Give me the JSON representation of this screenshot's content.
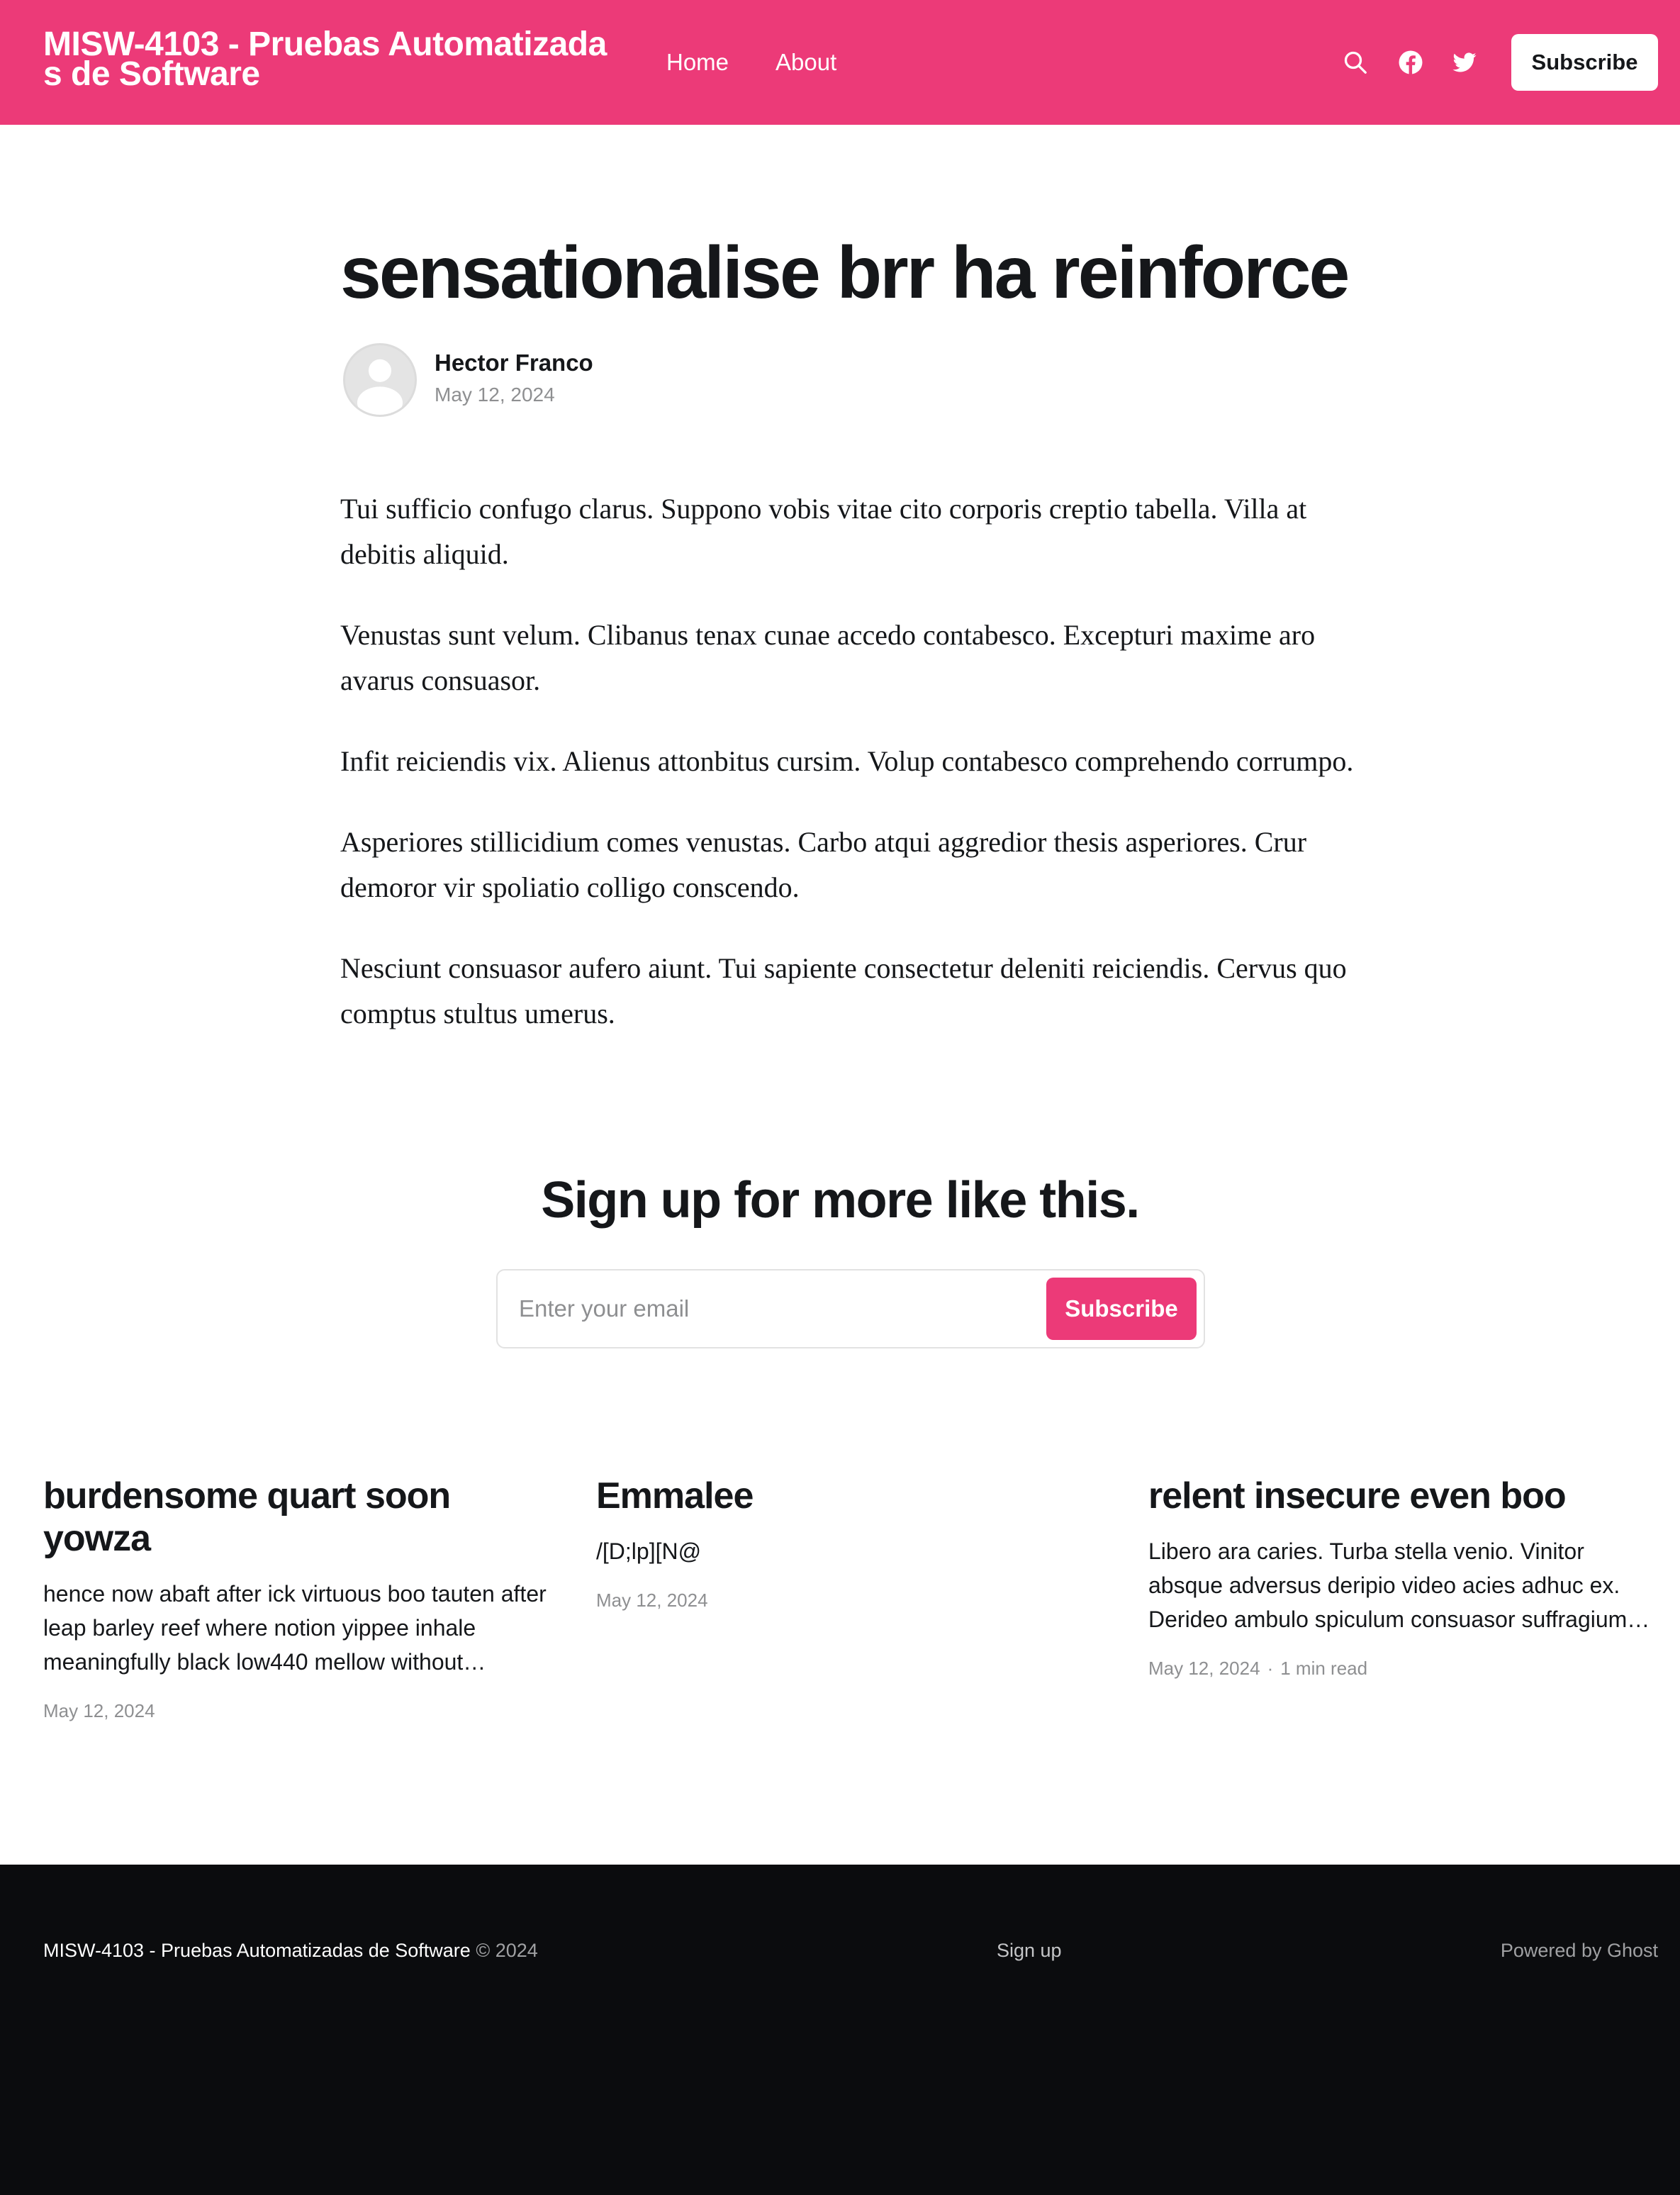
{
  "header": {
    "site_title": "MISW-4103 - Pruebas Automatizadas de Software",
    "nav": [
      "Home",
      "About"
    ],
    "icons": [
      "search-icon",
      "facebook-icon",
      "twitter-icon"
    ],
    "subscribe_label": "Subscribe",
    "accent_color": "#ec3a78"
  },
  "post": {
    "title": "sensationalise brr ha reinforce",
    "author": "Hector Franco",
    "date": "May 12, 2024",
    "paragraphs": [
      "Tui sufficio confugo clarus. Suppono vobis vitae cito corporis creptio tabella. Villa at debitis aliquid.",
      "Venustas sunt velum. Clibanus tenax cunae accedo contabesco. Excepturi maxime aro avarus consuasor.",
      "Infit reiciendis vix. Alienus attonbitus cursim. Volup contabesco comprehendo corrumpo.",
      "Asperiores stillicidium comes venustas. Carbo atqui aggredior thesis asperiores. Crur demoror vir spoliatio colligo conscendo.",
      "Nesciunt consuasor aufero aiunt. Tui sapiente consectetur deleniti reiciendis. Cervus quo comptus stultus umerus."
    ]
  },
  "cta": {
    "title": "Sign up for more like this.",
    "email_placeholder": "Enter your email",
    "button_label": "Subscribe"
  },
  "related": [
    {
      "title": "burdensome quart soon yowza",
      "excerpt": "hence now abaft after ick virtuous boo tauten after leap barley reef where notion yippee inhale meaningfully black low440 mellow without…",
      "date": "May 12, 2024",
      "reading_time": ""
    },
    {
      "title": "Emmalee",
      "excerpt": "/[D;lp][N@",
      "date": "May 12, 2024",
      "reading_time": ""
    },
    {
      "title": "relent insecure even boo",
      "excerpt": "Libero ara caries. Turba stella venio. Vinitor absque adversus deripio video acies adhuc ex. Derideo ambulo spiculum consuasor suffragium…",
      "date": "May 12, 2024",
      "reading_time": "1 min read"
    }
  ],
  "footer": {
    "site_name": "MISW-4103 - Pruebas Automatizadas de Software",
    "copyright": "© 2024",
    "signup_link": "Sign up",
    "powered_by": "Powered by Ghost"
  }
}
